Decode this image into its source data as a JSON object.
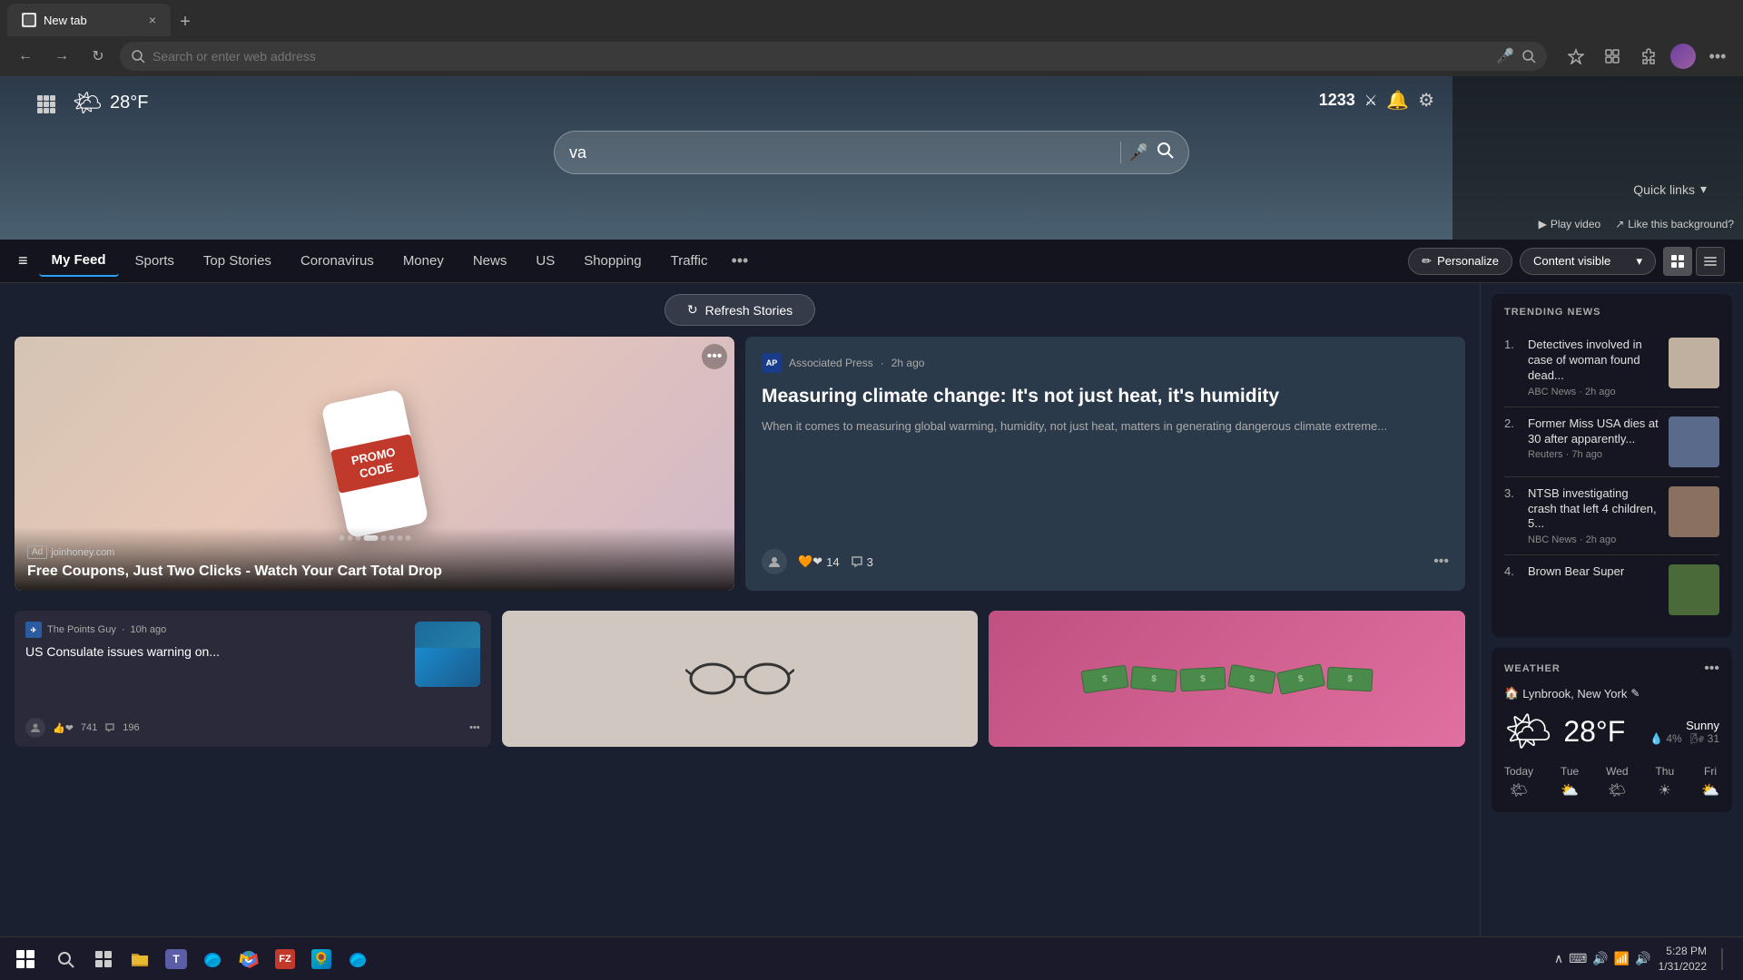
{
  "browser": {
    "tab_label": "New tab",
    "tab_icon": "🌐",
    "new_tab_icon": "+",
    "close_tab": "×",
    "nav": {
      "back": "←",
      "forward": "→",
      "refresh": "↻",
      "address": "Search or enter web address",
      "address_value": ""
    },
    "toolbar_icons": [
      "★",
      "⭐",
      "🧩",
      "⚙"
    ]
  },
  "newtab": {
    "weather": {
      "icon": "🌤",
      "temp": "28",
      "unit": "°F"
    },
    "search": {
      "value": "va",
      "placeholder": "Search or enter web address",
      "mic_icon": "🎤",
      "search_icon": "🔍"
    },
    "points": {
      "value": "1233",
      "icon": "⚔"
    },
    "quick_links": {
      "label": "Quick links",
      "chevron": "▾"
    },
    "play_video": "Play video",
    "like_bg": "Like this background?"
  },
  "nav_tabs": {
    "hamburger": "≡",
    "tabs": [
      {
        "label": "My Feed",
        "active": true
      },
      {
        "label": "Sports",
        "active": false
      },
      {
        "label": "Top Stories",
        "active": false
      },
      {
        "label": "Coronavirus",
        "active": false
      },
      {
        "label": "Money",
        "active": false
      },
      {
        "label": "News",
        "active": false
      },
      {
        "label": "US",
        "active": false
      },
      {
        "label": "Shopping",
        "active": false
      },
      {
        "label": "Traffic",
        "active": false
      }
    ],
    "more": "•••",
    "personalize": "✏ Personalize",
    "content_visible": "Content visible",
    "chevron": "▾",
    "grid_view": "⊞",
    "list_view": "≡"
  },
  "refresh": {
    "icon": "↻",
    "label": "Refresh Stories"
  },
  "featured_story": {
    "ad_badge": "Ad  joinhoney.com",
    "title": "Free Coupons, Just Two Clicks - Watch Your Cart Total Drop",
    "more": "•••",
    "promo_text": "PROMO CODE",
    "dots": 20
  },
  "climate_story": {
    "source": "Associated Press",
    "source_logo": "AP",
    "time_ago": "2h ago",
    "title": "Measuring climate change: It's not just heat, it's humidity",
    "description": "When it comes to measuring global warming, humidity, not just heat, matters in generating dangerous climate extreme...",
    "reactions_count": "14",
    "comments_count": "3",
    "more": "•••"
  },
  "small_stories": [
    {
      "source": "The Points Guy",
      "source_icon": "✈",
      "time_ago": "10h ago",
      "title": "US Consulate issues warning on...",
      "reactions": "741",
      "comments": "196",
      "has_thumb": true,
      "more": "•••"
    },
    {
      "source": "",
      "title": "",
      "type": "glasses_ad"
    },
    {
      "source": "",
      "title": "",
      "type": "money_img"
    }
  ],
  "trending": {
    "title": "TRENDING NEWS",
    "items": [
      {
        "num": "1.",
        "headline": "Detectives involved in case of woman found dead...",
        "source": "ABC News",
        "time": "2h ago",
        "thumb_color": "#c0b0a0"
      },
      {
        "num": "2.",
        "headline": "Former Miss USA dies at 30 after apparently...",
        "source": "Reuters",
        "time": "7h ago",
        "thumb_color": "#5a6a8a"
      },
      {
        "num": "3.",
        "headline": "NTSB investigating crash that left 4 children, 5...",
        "source": "NBC News",
        "time": "2h ago",
        "thumb_color": "#8a7060"
      },
      {
        "num": "4.",
        "headline": "Brown Bear Super",
        "source": "",
        "time": "",
        "thumb_color": "#4a6a3a"
      }
    ]
  },
  "weather_sidebar": {
    "title": "WEATHER",
    "more": "•••",
    "location": "Lynbrook, New York",
    "edit_icon": "✎",
    "sun_icon": "🌤",
    "temp": "28",
    "unit": "°F",
    "condition": "Sunny",
    "precip": "4%",
    "wind": "31",
    "forecast": [
      {
        "day": "Today"
      },
      {
        "day": "Tue"
      },
      {
        "day": "Wed"
      },
      {
        "day": "Thu"
      },
      {
        "day": "Fri"
      }
    ]
  },
  "taskbar": {
    "start_icon": "⊞",
    "search_icon": "🔍",
    "time": "5:28 PM",
    "date": "1/31/2022",
    "system_icons": [
      "∧",
      "⌨",
      "🔊",
      "📶"
    ]
  }
}
